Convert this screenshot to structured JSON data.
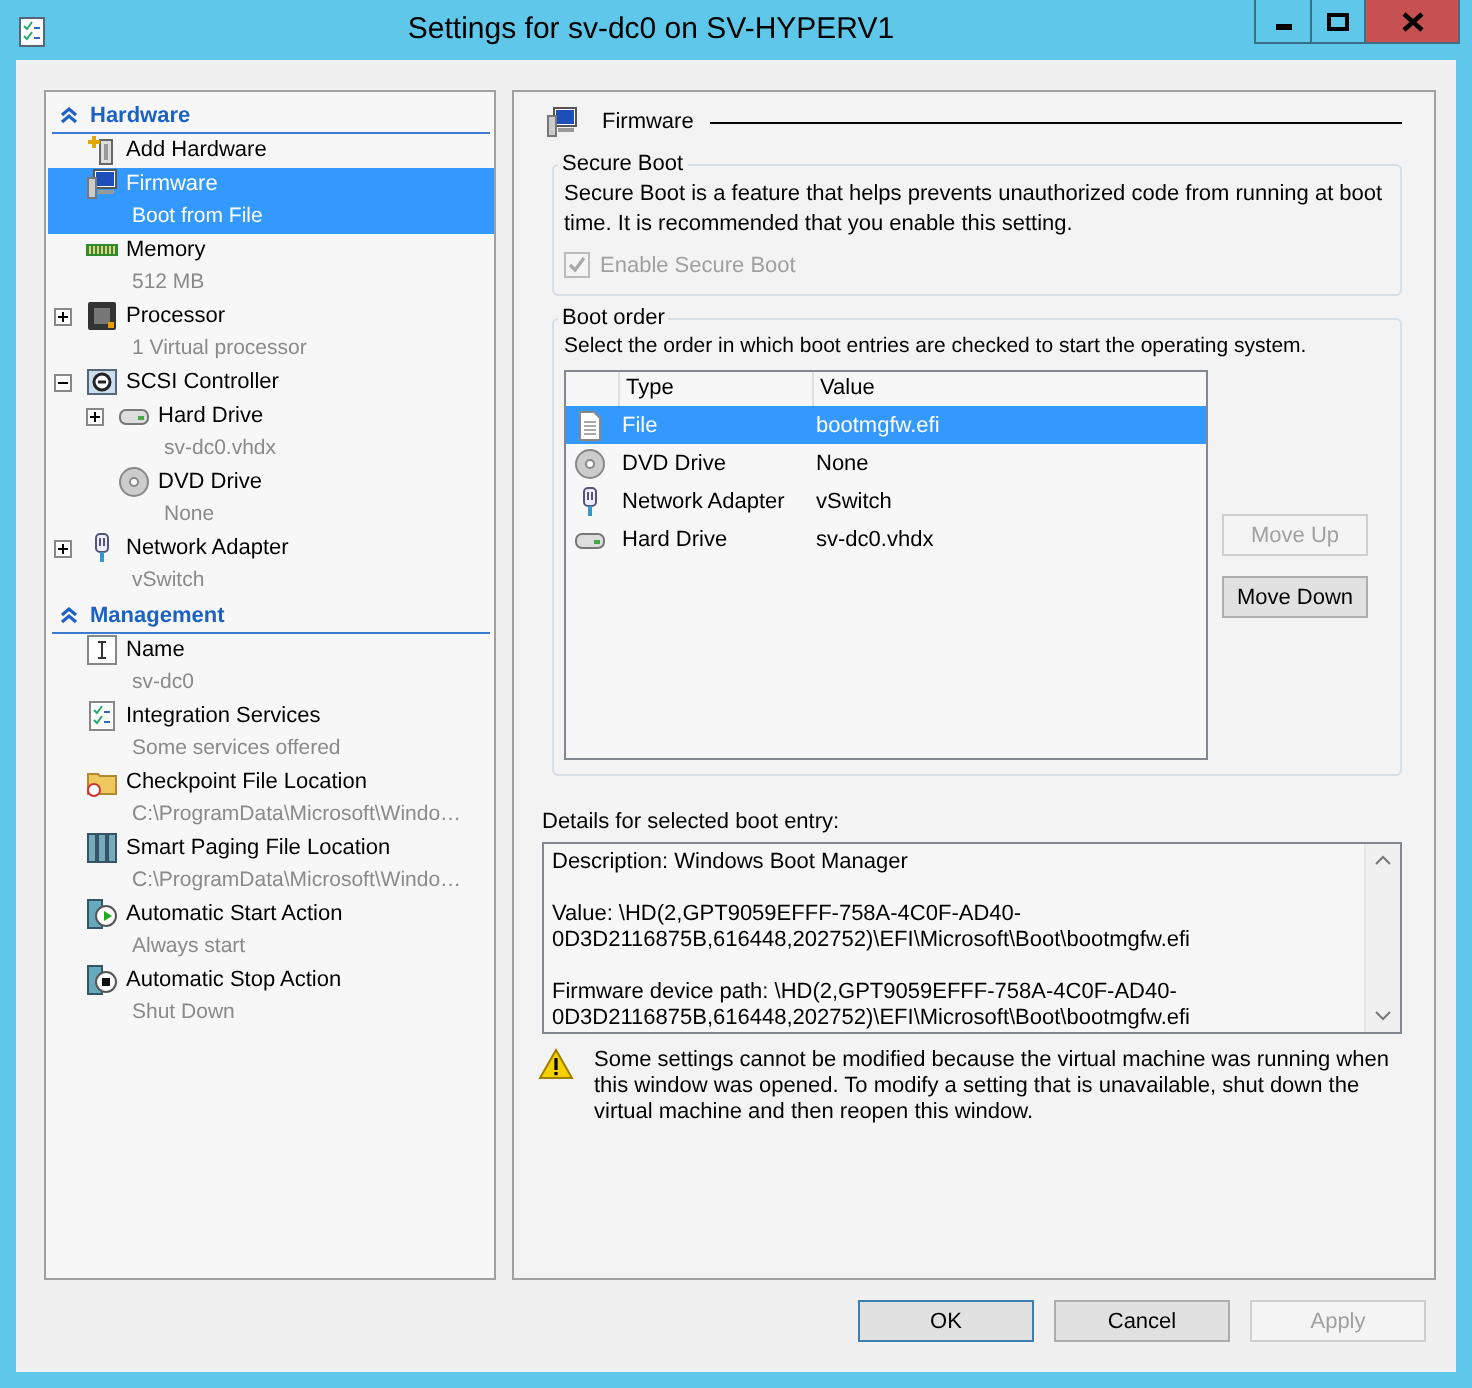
{
  "window": {
    "title": "Settings for sv-dc0 on SV-HYPERV1"
  },
  "sidebar": {
    "sections": [
      {
        "title": "Hardware",
        "items": [
          {
            "kind": "add-hardware",
            "label": "Add Hardware",
            "selected": false
          },
          {
            "kind": "firmware",
            "label": "Firmware",
            "detail": "Boot from File",
            "selected": true
          },
          {
            "kind": "memory",
            "label": "Memory",
            "detail": "512 MB",
            "selected": false
          },
          {
            "kind": "processor",
            "label": "Processor",
            "detail": "1 Virtual processor",
            "selected": false,
            "expanded": false
          },
          {
            "kind": "scsi",
            "label": "SCSI Controller",
            "selected": false,
            "expanded": true,
            "children": [
              {
                "kind": "hard-drive",
                "label": "Hard Drive",
                "detail": "sv-dc0.vhdx",
                "selected": false,
                "expanded": false
              },
              {
                "kind": "dvd",
                "label": "DVD Drive",
                "detail": "None",
                "selected": false
              }
            ]
          },
          {
            "kind": "network",
            "label": "Network Adapter",
            "detail": "vSwitch",
            "selected": false,
            "expanded": false
          }
        ]
      },
      {
        "title": "Management",
        "items": [
          {
            "kind": "name",
            "label": "Name",
            "detail": "sv-dc0",
            "selected": false
          },
          {
            "kind": "integration",
            "label": "Integration Services",
            "detail": "Some services offered",
            "selected": false
          },
          {
            "kind": "checkpoint",
            "label": "Checkpoint File Location",
            "detail": "C:\\ProgramData\\Microsoft\\Windo…",
            "selected": false
          },
          {
            "kind": "paging",
            "label": "Smart Paging File Location",
            "detail": "C:\\ProgramData\\Microsoft\\Windo…",
            "selected": false
          },
          {
            "kind": "start",
            "label": "Automatic Start Action",
            "detail": "Always start",
            "selected": false
          },
          {
            "kind": "stop",
            "label": "Automatic Stop Action",
            "detail": "Shut Down",
            "selected": false
          }
        ]
      }
    ]
  },
  "page": {
    "title": "Firmware",
    "secure_boot": {
      "title": "Secure Boot",
      "text": "Secure Boot is a feature that helps prevents unauthorized code from running at boot time. It is recommended that you enable this setting.",
      "checkbox": {
        "label": "Enable Secure Boot",
        "checked": true,
        "disabled": true
      }
    },
    "boot_order": {
      "title": "Boot order",
      "instruction": "Select the order in which boot entries are checked to start the operating system.",
      "columns": [
        "Type",
        "Value"
      ],
      "rows": [
        {
          "kind": "file",
          "type": "File",
          "value": "bootmgfw.efi",
          "selected": true
        },
        {
          "kind": "dvd",
          "type": "DVD Drive",
          "value": "None",
          "selected": false
        },
        {
          "kind": "network",
          "type": "Network Adapter",
          "value": "vSwitch",
          "selected": false
        },
        {
          "kind": "hard-drive",
          "type": "Hard Drive",
          "value": "sv-dc0.vhdx",
          "selected": false
        }
      ],
      "buttons": [
        {
          "label": "Move Up",
          "disabled": true
        },
        {
          "label": "Move Down",
          "disabled": false
        }
      ]
    },
    "details": {
      "label": "Details for selected boot entry:",
      "paragraphs": [
        [
          "Description: Windows Boot Manager"
        ],
        [
          "Value: \\HD(2,GPT9059EFFF-758A-4C0F-AD40-",
          "0D3D2116875B,616448,202752)\\EFI\\Microsoft\\Boot\\bootmgfw.efi"
        ],
        [
          "Firmware device path: \\HD(2,GPT9059EFFF-758A-4C0F-AD40-",
          "0D3D2116875B,616448,202752)\\EFI\\Microsoft\\Boot\\bootmgfw.efi"
        ]
      ]
    },
    "warning": "Some settings cannot be modified because the virtual machine was running when this window was opened. To modify a setting that is unavailable, shut down the virtual machine and then reopen this window."
  },
  "buttons": [
    {
      "label": "OK",
      "disabled": false,
      "default": true
    },
    {
      "label": "Cancel",
      "disabled": false,
      "default": false
    },
    {
      "label": "Apply",
      "disabled": true,
      "default": false
    }
  ]
}
